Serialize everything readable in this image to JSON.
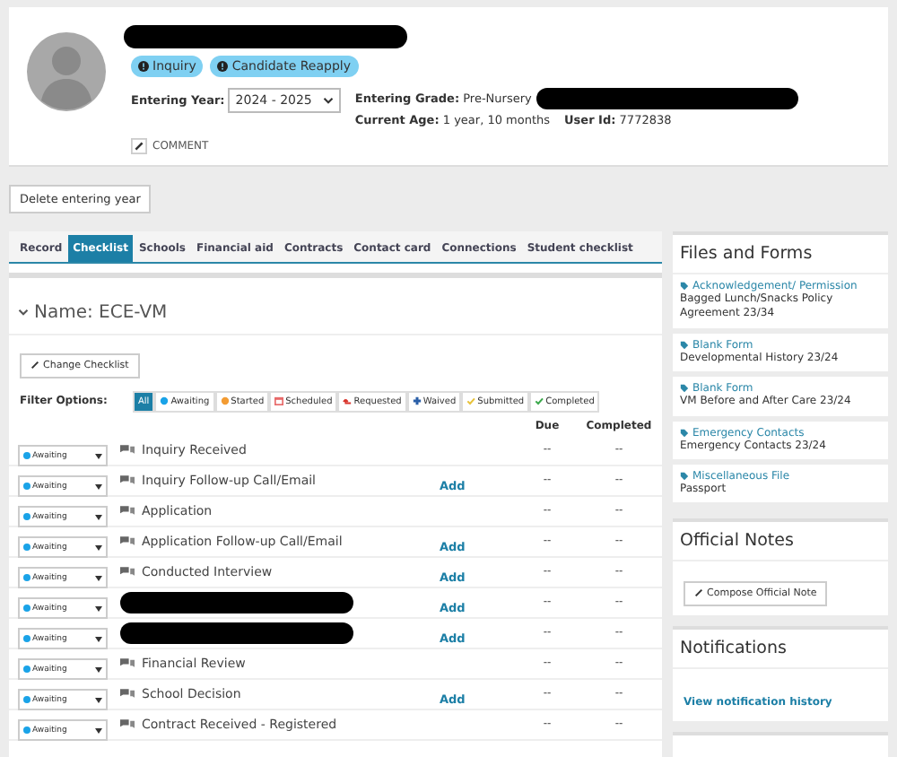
{
  "profile": {
    "name_redacted": true,
    "badges": [
      "Inquiry",
      "Candidate Reapply"
    ],
    "entering_year_label": "Entering Year:",
    "entering_year": "2024 - 2025",
    "entering_grade_label": "Entering Grade:",
    "entering_grade": "Pre-Nursery",
    "grade_redacted": true,
    "age_label": "Current Age:",
    "age": "1 year, 10 months",
    "user_id_label": "User Id:",
    "user_id": "7772838",
    "comment": "COMMENT"
  },
  "delete_button": "Delete entering year",
  "tabs": [
    {
      "label": "Record",
      "selected": false
    },
    {
      "label": "Checklist",
      "selected": true
    },
    {
      "label": "Schools",
      "selected": false
    },
    {
      "label": "Financial aid",
      "selected": false
    },
    {
      "label": "Contracts",
      "selected": false
    },
    {
      "label": "Contact card",
      "selected": false
    },
    {
      "label": "Connections",
      "selected": false
    },
    {
      "label": "Student checklist",
      "selected": false
    }
  ],
  "checklist": {
    "name": "Name: ECE-VM",
    "change_button": "Change Checklist",
    "filter_label": "Filter Options:",
    "filters": [
      {
        "label": "All",
        "kind": "all",
        "selected": true
      },
      {
        "label": "Awaiting",
        "kind": "awaiting",
        "selected": false
      },
      {
        "label": "Started",
        "kind": "started",
        "selected": false
      },
      {
        "label": "Scheduled",
        "kind": "scheduled",
        "selected": false
      },
      {
        "label": "Requested",
        "kind": "requested",
        "selected": false
      },
      {
        "label": "Waived",
        "kind": "waived",
        "selected": false
      },
      {
        "label": "Submitted",
        "kind": "submitted",
        "selected": false
      },
      {
        "label": "Completed",
        "kind": "completed",
        "selected": false
      }
    ],
    "columns": [
      "Due",
      "Completed"
    ],
    "rows": [
      {
        "status": "Awaiting",
        "title": "Inquiry Received",
        "add": null,
        "due": "--",
        "completed": "--"
      },
      {
        "status": "Awaiting",
        "title": "Inquiry Follow-up Call/Email",
        "add": "Add",
        "due": "--",
        "completed": "--"
      },
      {
        "status": "Awaiting",
        "title": "Application",
        "add": null,
        "due": "--",
        "completed": "--"
      },
      {
        "status": "Awaiting",
        "title": "Application Follow-up Call/Email",
        "add": "Add",
        "due": "--",
        "completed": "--"
      },
      {
        "status": "Awaiting",
        "title": "Conducted Interview",
        "add": "Add",
        "due": "--",
        "completed": "--"
      },
      {
        "status": "Awaiting",
        "title": null,
        "add": "Add",
        "due": "--",
        "completed": "--"
      },
      {
        "status": "Awaiting",
        "title": null,
        "add": "Add",
        "due": "--",
        "completed": "--"
      },
      {
        "status": "Awaiting",
        "title": "Financial Review",
        "add": null,
        "due": "--",
        "completed": "--"
      },
      {
        "status": "Awaiting",
        "title": "School Decision",
        "add": "Add",
        "due": "--",
        "completed": "--"
      },
      {
        "status": "Awaiting",
        "title": "Contract Received - Registered",
        "add": null,
        "due": "--",
        "completed": "--"
      }
    ]
  },
  "files_and_forms": {
    "title": "Files and Forms",
    "items": [
      {
        "type": "Acknowledgement/ Permission",
        "name": "Bagged Lunch/Snacks Policy Agreement 23/34"
      },
      {
        "type": "Blank Form",
        "name": "Developmental History 23/24"
      },
      {
        "type": "Blank Form",
        "name": "VM Before and After Care 23/24"
      },
      {
        "type": "Emergency Contacts",
        "name": "Emergency Contacts 23/24"
      },
      {
        "type": "Miscellaneous File",
        "name": "Passport"
      }
    ]
  },
  "official_notes": {
    "title": "Official Notes",
    "button": "Compose Official Note"
  },
  "notifications": {
    "title": "Notifications",
    "link": "View notification history"
  }
}
